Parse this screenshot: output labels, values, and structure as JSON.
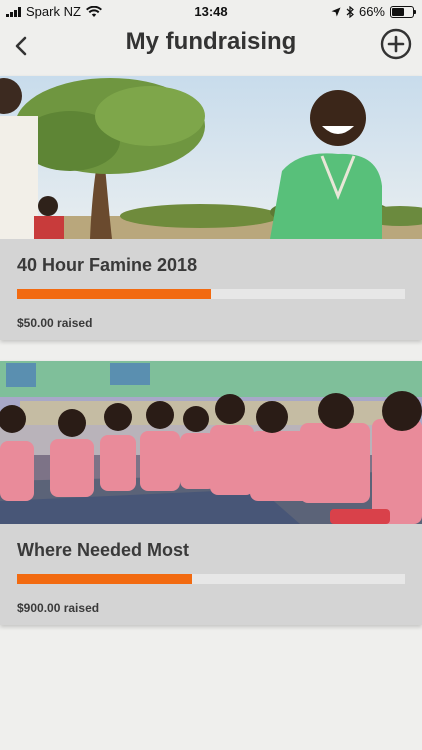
{
  "status_bar": {
    "carrier": "Spark NZ",
    "time": "13:48",
    "battery": "66%",
    "battery_level": 0.66
  },
  "header": {
    "title": "My fundraising",
    "back_icon": "chevron-left-icon",
    "add_icon": "plus-circle-icon"
  },
  "campaigns": [
    {
      "name": "40 Hour Famine 2018",
      "raised": "$50.00 raised",
      "progress": 0.5,
      "image": "boy-smiling-in-field-photo"
    },
    {
      "name": "Where Needed Most",
      "raised": "$900.00 raised",
      "progress": 0.45,
      "image": "schoolchildren-sitting-on-mat-photo"
    }
  ],
  "colors": {
    "accent": "#f26a10",
    "card_bg": "#d4d4d4",
    "page_bg": "#efefed",
    "track_bg": "#e7e7e7"
  }
}
